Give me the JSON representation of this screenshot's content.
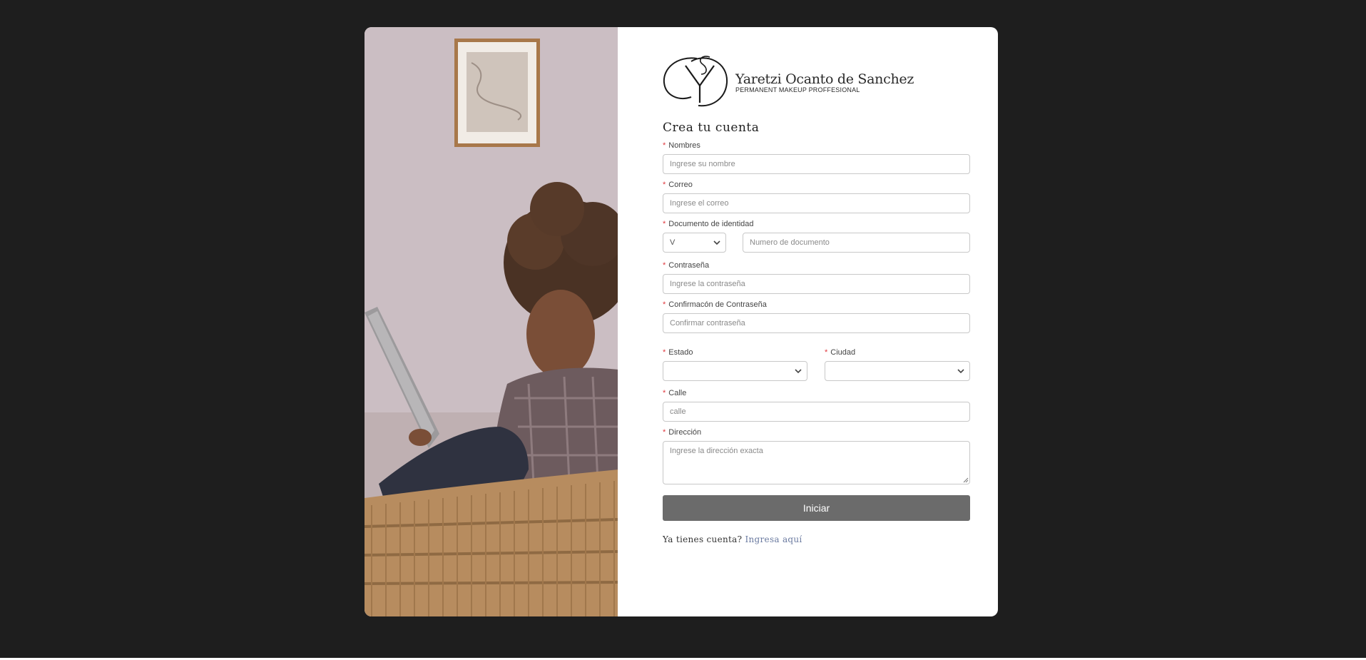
{
  "brand": {
    "name": "Yaretzi Ocanto de Sanchez",
    "subtitle": "PERMANENT MAKEUP PROFFESIONAL",
    "monogram": "YS"
  },
  "form": {
    "title": "Crea tu cuenta",
    "fields": {
      "nombres": {
        "label": "Nombres",
        "placeholder": "Ingrese su nombre"
      },
      "correo": {
        "label": "Correo",
        "placeholder": "Ingrese el correo"
      },
      "documento": {
        "label": "Documento de identidad",
        "type_value": "V",
        "placeholder": "Numero de documento"
      },
      "contrasena": {
        "label": "Contraseña",
        "placeholder": "Ingrese la contraseña"
      },
      "confirmacion": {
        "label": "Confirmacón de Contraseña",
        "placeholder": "Confirmar contraseña"
      },
      "estado": {
        "label": "Estado",
        "value": ""
      },
      "ciudad": {
        "label": "Ciudad",
        "value": ""
      },
      "calle": {
        "label": "Calle",
        "placeholder": "calle"
      },
      "direccion": {
        "label": "Dirección",
        "placeholder": "Ingrese la dirección exacta"
      }
    },
    "required_marker": "*",
    "submit_label": "Iniciar",
    "login_prompt": "Ya tienes cuenta?",
    "login_link": "Ingresa aquí"
  },
  "colors": {
    "page_background": "#1e1e1e",
    "card_background": "#ffffff",
    "submit_button": "#6b6b6b",
    "required_marker": "#e0383e",
    "link": "#6a7aa0"
  }
}
